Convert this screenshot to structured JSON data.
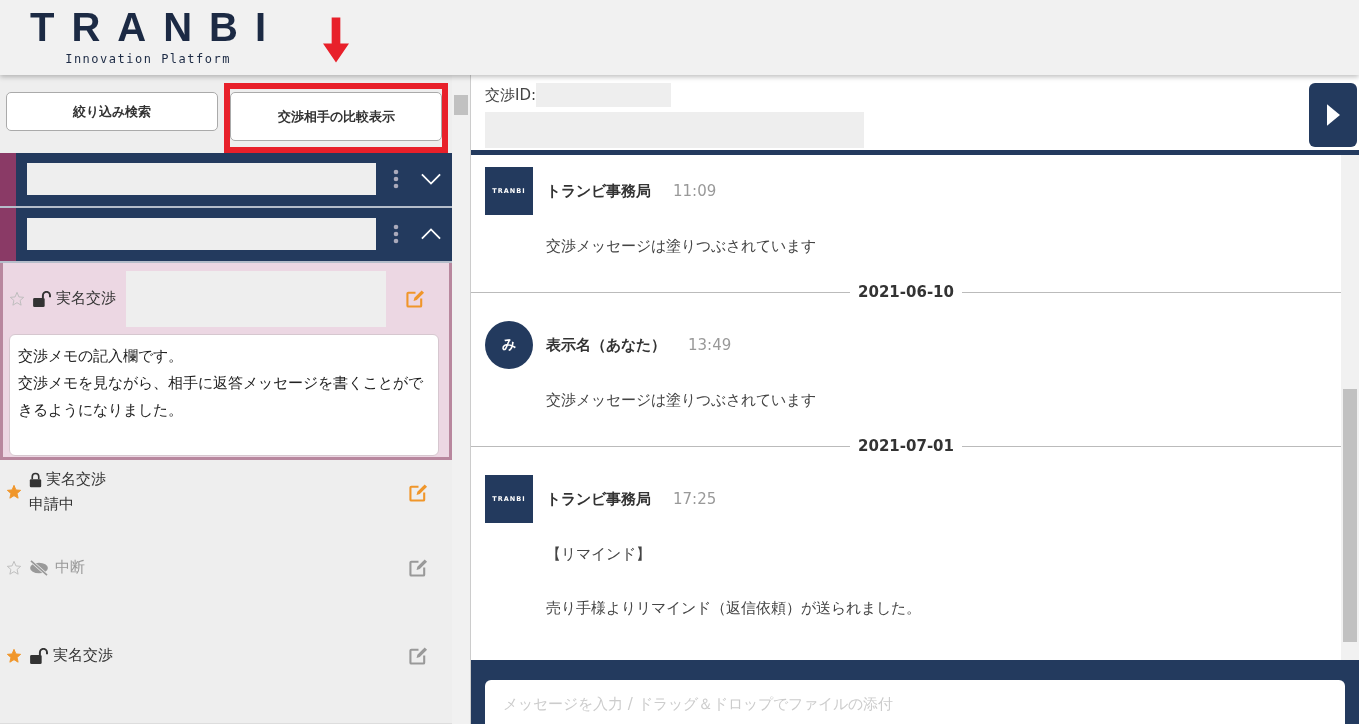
{
  "header": {
    "logo": "TRANBI",
    "tagline": "Innovation Platform"
  },
  "sidebar": {
    "buttons": [
      {
        "label": "絞り込み検索",
        "highlighted": false
      },
      {
        "label": "交渉相手の比較表示",
        "highlighted": true
      }
    ],
    "groups": [
      {
        "expanded": false
      },
      {
        "expanded": true
      }
    ],
    "deals": [
      {
        "kind": "unlocked",
        "selected": true,
        "starred": false,
        "label": "実名交渉",
        "edit_active": true,
        "memo": [
          "交渉メモの記入欄です。",
          "交渉メモを見ながら、相手に返答メッセージを書くことができるようになりました。"
        ]
      },
      {
        "kind": "locked",
        "selected": false,
        "starred": true,
        "label": "実名交渉",
        "status": "申請中",
        "edit_active": true
      },
      {
        "kind": "hidden",
        "selected": false,
        "starred": false,
        "label": "中断",
        "edit_active": false
      },
      {
        "kind": "unlocked",
        "selected": false,
        "starred": true,
        "label": "実名交渉",
        "edit_active": false
      }
    ]
  },
  "chat": {
    "id_label": "交渉ID:",
    "items": [
      {
        "kind": "logo_message",
        "avatar_text": "TRANBI",
        "sender": "トランビ事務局",
        "time": "11:09",
        "lines": [
          "交渉メッセージは塗りつぶされています"
        ]
      },
      {
        "kind": "date",
        "text": "2021-06-10"
      },
      {
        "kind": "user_message",
        "avatar_text": "み",
        "sender": "表示名（あなた）",
        "time": "13:49",
        "lines": [
          "交渉メッセージは塗りつぶされています"
        ]
      },
      {
        "kind": "date",
        "text": "2021-07-01"
      },
      {
        "kind": "logo_message",
        "avatar_text": "TRANBI",
        "sender": "トランビ事務局",
        "time": "17:25",
        "lines": [
          "【リマインド】",
          "売り手様よりリマインド（返信依頼）が送られました。"
        ]
      }
    ],
    "composer": {
      "placeholder": "メッセージを入力 / ドラッグ＆ドロップでファイルの添付"
    }
  }
}
